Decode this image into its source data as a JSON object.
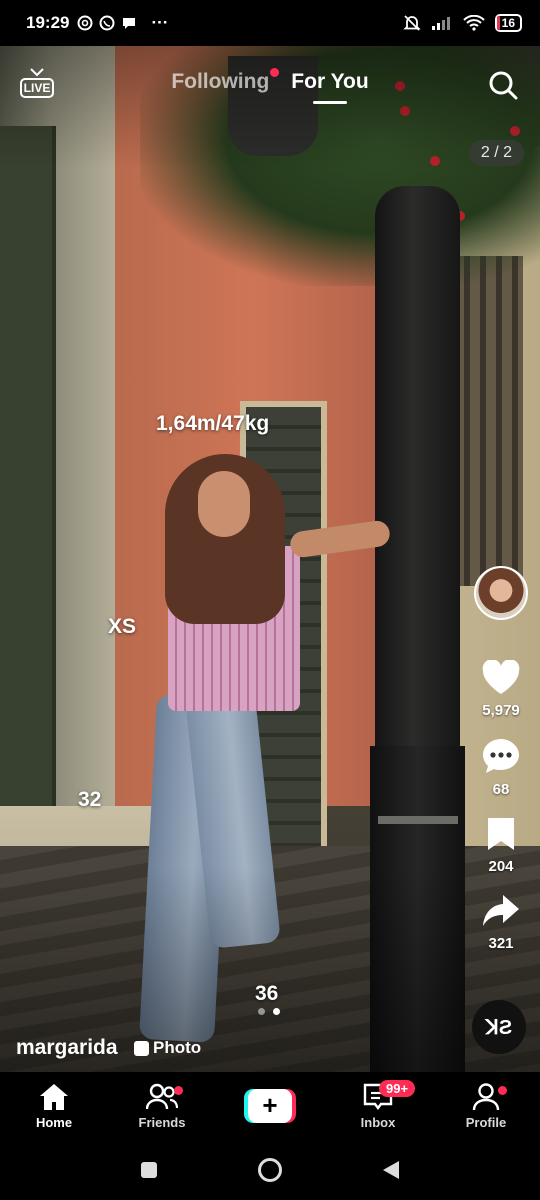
{
  "status_bar": {
    "time": "19:29",
    "battery": "16",
    "overflow": "···"
  },
  "top_nav": {
    "live_label": "LIVE",
    "tabs": [
      {
        "label": "Following",
        "active": false,
        "has_dot": true
      },
      {
        "label": "For You",
        "active": true
      }
    ],
    "photo_counter": "2 / 2"
  },
  "overlay_text": {
    "measurements": "1,64m/47kg",
    "size_top": "XS",
    "size_shoe": "32",
    "size_jeans": "36"
  },
  "actions": {
    "likes": "5,979",
    "comments": "68",
    "saves": "204",
    "shares": "321"
  },
  "music_disc_label": "ꓘƧ",
  "caption": {
    "username": "margarida",
    "type_badge": "Photo",
    "slide_total": 2,
    "slide_active": 2
  },
  "bottom_nav": {
    "items": [
      {
        "label": "Home",
        "icon": "home-icon",
        "active": true
      },
      {
        "label": "Friends",
        "icon": "friends-icon",
        "has_dot": true
      },
      {
        "label": "",
        "icon": "create-plus-icon"
      },
      {
        "label": "Inbox",
        "icon": "inbox-icon",
        "badge": "99+"
      },
      {
        "label": "Profile",
        "icon": "profile-icon",
        "has_dot": true
      }
    ]
  },
  "colors": {
    "accent_red": "#fe2c55",
    "accent_cyan": "#25f4ee",
    "background": "#000000"
  }
}
